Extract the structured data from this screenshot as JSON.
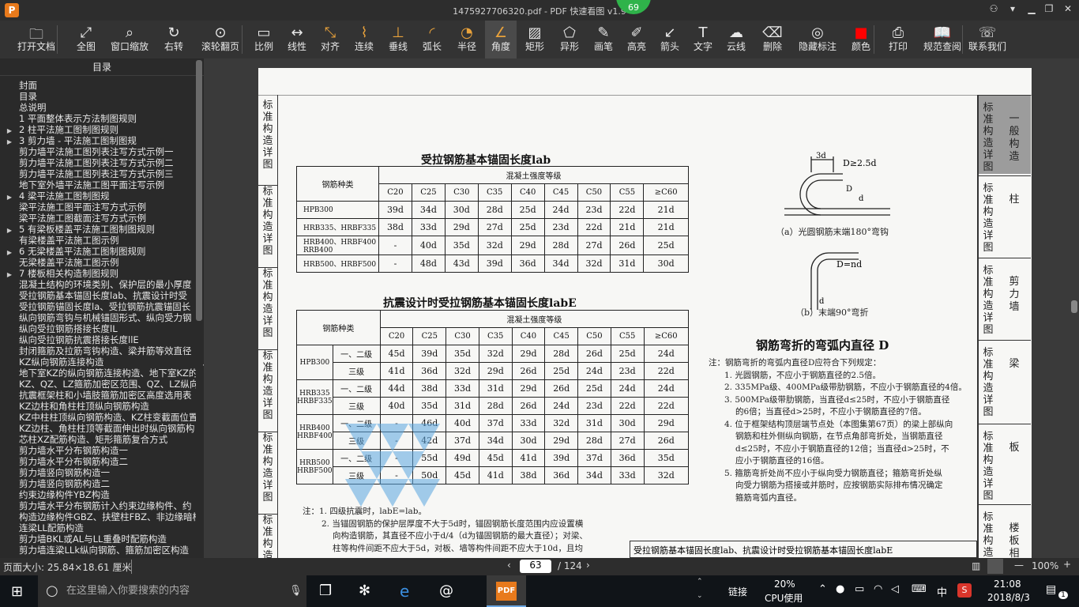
{
  "window": {
    "title": "1475927706320.pdf - PDF 快速看图 v1.9",
    "badge": "69",
    "min": "▁",
    "restore": "❐",
    "close": "✕",
    "user": "⚇",
    "dropdown": "▾"
  },
  "toolbar": [
    {
      "label": "打开文档",
      "icon": "folder-icon",
      "glyph": "🗀"
    },
    {
      "label": "全图",
      "icon": "fit-all-icon",
      "glyph": "⤢"
    },
    {
      "label": "窗口缩放",
      "icon": "zoom-window-icon",
      "glyph": "⌕"
    },
    {
      "label": "右转",
      "icon": "rotate-right-icon",
      "glyph": "↻"
    },
    {
      "label": "滚轮翻页",
      "icon": "mouse-wheel-icon",
      "glyph": "⊙"
    },
    {
      "label": "比例",
      "icon": "scale-icon",
      "glyph": "▭"
    },
    {
      "label": "线性",
      "icon": "linear-measure-icon",
      "glyph": "↔"
    },
    {
      "label": "对齐",
      "icon": "aligned-measure-icon",
      "glyph": "⤡"
    },
    {
      "label": "连续",
      "icon": "continuous-measure-icon",
      "glyph": "⌇"
    },
    {
      "label": "垂线",
      "icon": "perpendicular-icon",
      "glyph": "⊥"
    },
    {
      "label": "弧长",
      "icon": "arc-length-icon",
      "glyph": "◜"
    },
    {
      "label": "半径",
      "icon": "radius-icon",
      "glyph": "◔"
    },
    {
      "label": "角度",
      "icon": "angle-icon",
      "glyph": "∠"
    },
    {
      "label": "矩形",
      "icon": "rectangle-area-icon",
      "glyph": "▨"
    },
    {
      "label": "异形",
      "icon": "polygon-area-icon",
      "glyph": "⬠"
    },
    {
      "label": "画笔",
      "icon": "pen-icon",
      "glyph": "✎"
    },
    {
      "label": "高亮",
      "icon": "highlighter-icon",
      "glyph": "✐"
    },
    {
      "label": "箭头",
      "icon": "arrow-icon",
      "glyph": "↙"
    },
    {
      "label": "文字",
      "icon": "text-icon",
      "glyph": "T"
    },
    {
      "label": "云线",
      "icon": "cloud-line-icon",
      "glyph": "☁"
    },
    {
      "label": "删除",
      "icon": "eraser-icon",
      "glyph": "⌫"
    },
    {
      "label": "隐藏标注",
      "icon": "hide-annotation-icon",
      "glyph": "◎"
    },
    {
      "label": "颜色",
      "icon": "color-swatch-icon",
      "glyph": "■"
    },
    {
      "label": "打印",
      "icon": "printer-icon",
      "glyph": "⎙"
    },
    {
      "label": "规范查阅",
      "icon": "book-icon",
      "glyph": "📖"
    },
    {
      "label": "联系我们",
      "icon": "support-icon",
      "glyph": "☏"
    }
  ],
  "sidebar": {
    "title": "目录",
    "items": [
      {
        "t": "封面",
        "a": ""
      },
      {
        "t": "目录",
        "a": ""
      },
      {
        "t": "总说明",
        "a": ""
      },
      {
        "t": "1 平面整体表示方法制图规则",
        "a": ""
      },
      {
        "t": "2 柱平法施工图制图规则",
        "a": "▶"
      },
      {
        "t": "3 剪力墙 - 平法施工图制图规",
        "a": "▶"
      },
      {
        "t": "剪力墙平法施工图列表注写方式示例一",
        "a": ""
      },
      {
        "t": "剪力墙平法施工图列表注写方式示例二",
        "a": ""
      },
      {
        "t": "剪力墙平法施工图列表注写方式示例三",
        "a": ""
      },
      {
        "t": "地下室外墙平法施工图平面注写示例",
        "a": ""
      },
      {
        "t": "4 梁平法施工图制图规",
        "a": "▶"
      },
      {
        "t": "梁平法施工图平面注写方式示例",
        "a": ""
      },
      {
        "t": "梁平法施工图截面注写方式示例",
        "a": ""
      },
      {
        "t": "5 有梁板楼盖平法施工图制图规则",
        "a": "▶"
      },
      {
        "t": "有梁楼盖平法施工图示例",
        "a": ""
      },
      {
        "t": "6 无梁楼盖平法施工图制图规则",
        "a": "▶"
      },
      {
        "t": "无梁楼盖平法施工图示例",
        "a": ""
      },
      {
        "t": "7 楼板相关构造制图规则",
        "a": "▶"
      },
      {
        "t": "混凝土结构的环境类别、保护层的最小厚度",
        "a": ""
      },
      {
        "t": "受拉钢筋基本锚固长度lab、抗震设计时受",
        "a": ""
      },
      {
        "t": "受拉钢筋锚固长度la、受拉钢筋抗震锚固长",
        "a": ""
      },
      {
        "t": "纵向钢筋弯钩与机械锚固形式、纵向受力钢",
        "a": ""
      },
      {
        "t": "纵向受拉钢筋搭接长度lL",
        "a": ""
      },
      {
        "t": "纵向受拉钢筋抗震搭接长度llE",
        "a": ""
      },
      {
        "t": "封闭箍筋及拉筋弯钩构造、梁并筋等效直径",
        "a": ""
      },
      {
        "t": "KZ纵向钢筋连接构造",
        "a": ""
      },
      {
        "t": "地下室KZ的纵向钢筋连接构造、地下室KZ的",
        "a": ""
      },
      {
        "t": "KZ、QZ、LZ箍筋加密区范围、QZ、LZ纵向钢",
        "a": ""
      },
      {
        "t": "抗震框架柱和小墙肢箍筋加密区高度选用表",
        "a": ""
      },
      {
        "t": "KZ边柱和角柱柱顶纵向钢筋构造",
        "a": ""
      },
      {
        "t": "KZ中柱柱顶纵向钢筋构造、KZ柱变截面位置",
        "a": ""
      },
      {
        "t": "KZ边柱、角柱柱顶等截面伸出时纵向钢筋构",
        "a": ""
      },
      {
        "t": "芯柱XZ配筋构造、矩形箍筋复合方式",
        "a": ""
      },
      {
        "t": "剪力墙水平分布钢筋构造一",
        "a": ""
      },
      {
        "t": "剪力墙水平分布钢筋构造二",
        "a": ""
      },
      {
        "t": "剪力墙竖向钢筋构造一",
        "a": ""
      },
      {
        "t": "剪力墙竖向钢筋构造二",
        "a": ""
      },
      {
        "t": "约束边缘构件YBZ构造",
        "a": ""
      },
      {
        "t": "剪力墙水平分布钢筋计入约束边缘构件、约",
        "a": ""
      },
      {
        "t": "构造边缘构件GBZ、扶壁柱FBZ、非边缘暗柱",
        "a": ""
      },
      {
        "t": "连梁LL配筋构造",
        "a": ""
      },
      {
        "t": "剪力墙BKL或AL与LL重叠时配筋构造",
        "a": ""
      },
      {
        "t": "剪力墙连梁LLk纵向钢筋、箍筋加密区构造",
        "a": ""
      }
    ]
  },
  "doc": {
    "left_tabs": [
      "标准构造详图",
      "标准构造详图",
      "标准构造详图",
      "标准构造详图",
      "标准构造详图",
      "标准构造"
    ],
    "right_tabs": [
      {
        "a": "标准构造详图",
        "b": "一般构造",
        "active": true
      },
      {
        "a": "标准构造详图",
        "b": "柱"
      },
      {
        "a": "标准构造详图",
        "b": "剪力墙"
      },
      {
        "a": "标准构造详图",
        "b": "梁"
      },
      {
        "a": "标准构造详图",
        "b": "板"
      },
      {
        "a": "标准构造",
        "b": "楼板相关"
      }
    ],
    "table1": {
      "title": "受拉钢筋基本锚固长度lab",
      "grade_header": "混凝土强度等级",
      "type_header": "钢筋种类",
      "cols": [
        "C20",
        "C25",
        "C30",
        "C35",
        "C40",
        "C45",
        "C50",
        "C55",
        "≥C60"
      ],
      "rows": [
        {
          "name": "HPB300",
          "v": [
            "39d",
            "34d",
            "30d",
            "28d",
            "25d",
            "24d",
            "23d",
            "22d",
            "21d"
          ]
        },
        {
          "name": "HRB335、HRBF335",
          "v": [
            "38d",
            "33d",
            "29d",
            "27d",
            "25d",
            "23d",
            "22d",
            "21d",
            "21d"
          ]
        },
        {
          "name": "HRB400、HRBF400 RRB400",
          "v": [
            "-",
            "40d",
            "35d",
            "32d",
            "29d",
            "28d",
            "27d",
            "26d",
            "25d"
          ]
        },
        {
          "name": "HRB500、HRBF500",
          "v": [
            "-",
            "48d",
            "43d",
            "39d",
            "36d",
            "34d",
            "32d",
            "31d",
            "30d"
          ]
        }
      ]
    },
    "table2": {
      "title": "抗震设计时受拉钢筋基本锚固长度labE",
      "grade_header": "混凝土强度等级",
      "type_header": "钢筋种类",
      "cols": [
        "C20",
        "C25",
        "C30",
        "C35",
        "C40",
        "C45",
        "C50",
        "C55",
        "≥C60"
      ],
      "groups": [
        {
          "name": "HPB300",
          "rows": [
            {
              "lv": "一、二级",
              "v": [
                "45d",
                "39d",
                "35d",
                "32d",
                "29d",
                "28d",
                "26d",
                "25d",
                "24d"
              ]
            },
            {
              "lv": "三级",
              "v": [
                "41d",
                "36d",
                "32d",
                "29d",
                "26d",
                "25d",
                "24d",
                "23d",
                "22d"
              ]
            }
          ]
        },
        {
          "name": "HRB335 HRBF335",
          "rows": [
            {
              "lv": "一、二级",
              "v": [
                "44d",
                "38d",
                "33d",
                "31d",
                "29d",
                "26d",
                "25d",
                "24d",
                "24d"
              ]
            },
            {
              "lv": "三级",
              "v": [
                "40d",
                "35d",
                "31d",
                "28d",
                "26d",
                "24d",
                "23d",
                "22d",
                "22d"
              ]
            }
          ]
        },
        {
          "name": "HRB400 HRBF400",
          "rows": [
            {
              "lv": "一、二级",
              "v": [
                "-",
                "46d",
                "40d",
                "37d",
                "33d",
                "32d",
                "31d",
                "30d",
                "29d"
              ]
            },
            {
              "lv": "三级",
              "v": [
                "-",
                "42d",
                "37d",
                "34d",
                "30d",
                "29d",
                "28d",
                "27d",
                "26d"
              ]
            }
          ]
        },
        {
          "name": "HRB500 HRBF500",
          "rows": [
            {
              "lv": "一、二级",
              "v": [
                "-",
                "55d",
                "49d",
                "45d",
                "41d",
                "39d",
                "37d",
                "36d",
                "35d"
              ]
            },
            {
              "lv": "三级",
              "v": [
                "-",
                "50d",
                "45d",
                "41d",
                "38d",
                "36d",
                "34d",
                "33d",
                "32d"
              ]
            }
          ]
        }
      ]
    },
    "notes_left": [
      "注：1. 四级抗震时，labE=lab。",
      "2. 当锚固钢筋的保护层厚度不大于5d时，锚固钢筋长度范围内应设置横",
      "向构造钢筋，其直径不应小于d/4（d为锚固钢筋的最大直径）；对梁、",
      "柱等构件间距不应大于5d，对板、墙等构件间距不应大于10d，且均"
    ],
    "fig_a": "（a）光圆钢筋末端180°弯钩",
    "fig_b": "（b）末端90°弯折",
    "fig_a_dim1": "3d",
    "fig_a_dim2": "D≥2.5d",
    "fig_a_dim3": "d",
    "fig_a_dim4": "D",
    "fig_b_dim": "D=nd",
    "fig_b_d": "d",
    "bend_title": "钢筋弯折的弯弧内直径 D",
    "notes_right": [
      "注：钢筋弯折的弯弧内直径D应符合下列规定：",
      "1. 光圆钢筋，不应小于钢筋直径的2.5倍。",
      "2. 335MPa级、400MPa级带肋钢筋，不应小于钢筋直径的4倍。",
      "3. 500MPa级带肋钢筋，当直径d≤25时，不应小于钢筋直径",
      "的6倍；当直径d>25时，不应小于钢筋直径的7倍。",
      "4. 位于框架结构顶层端节点处（本图集第67页）的梁上部纵向",
      "钢筋和柱外侧纵向钢筋，在节点角部弯折处，当钢筋直径",
      "d≤25时，不应小于钢筋直径的12倍；当直径d>25时，不",
      "应小于钢筋直径的16倍。",
      "5. 箍筋弯折处尚不应小于纵向受力钢筋直径；箍筋弯折处纵",
      "向受力钢筋为搭接或并筋时，应按钢筋实际排布情况确定",
      "箍筋弯弧内直径。"
    ],
    "footer_title": "受拉钢筋基本锚固长度lab、抗震设计时受拉钢筋基本锚固长度labE"
  },
  "status": {
    "page_size": "页面大小: 25.84×18.61 厘米",
    "page": "63",
    "total": "/ 124",
    "zoom": "100%",
    "prev": "‹",
    "next": "›",
    "minus": "—",
    "plus": "+"
  },
  "taskbar": {
    "search_placeholder": "在这里输入你要搜索的内容",
    "link": "链接",
    "cpu": "20%",
    "cpu_label": "CPU使用",
    "ime": "中",
    "time": "21:08",
    "date": "2018/8/3",
    "notif": "1",
    "pdf": "PDF"
  }
}
